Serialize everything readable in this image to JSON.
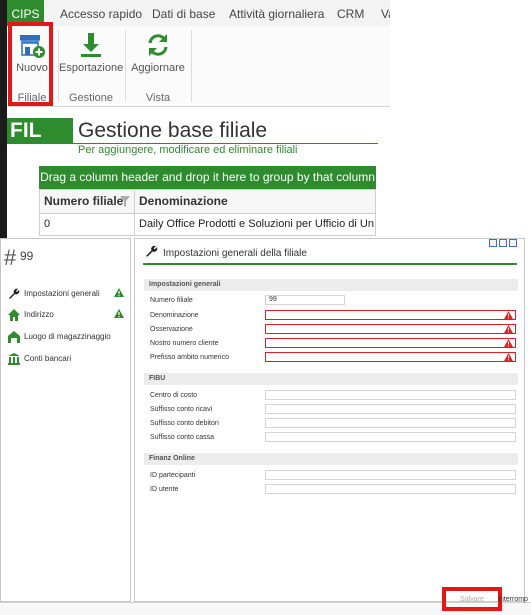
{
  "tabs": [
    "CIPS",
    "Accesso rapido",
    "Dati di base",
    "Attività giornaliera",
    "CRM",
    "Va"
  ],
  "ribbon": {
    "buttons": {
      "new": "Nuovo",
      "export": "Esportazione",
      "refresh": "Aggiornare"
    },
    "groups": {
      "branch": "Filiale",
      "management": "Gestione",
      "view": "Vista"
    }
  },
  "header": {
    "badge": "FIL",
    "title": "Gestione base filiale",
    "subtitle": "Per aggiungere, modificare ed eliminare filiali"
  },
  "grid": {
    "group_hint": "Drag a column header and drop it here to group by that column",
    "columns": [
      "Numero filiale",
      "Denominazione"
    ],
    "rows": [
      [
        "0",
        "Daily Office Prodotti e Soluzioni per Ufficio di Un"
      ]
    ]
  },
  "record": {
    "hash": "#",
    "id": "99"
  },
  "nav": [
    "Impostazioni generali",
    "Indirizzo",
    "Luogo di magazzinaggio",
    "Conti bancari"
  ],
  "settings": {
    "title": "Impostazioni generali della filiale",
    "sections": {
      "general": {
        "label": "Impostazioni generali",
        "fields": [
          {
            "label": "Numero filiale",
            "value": "99"
          },
          {
            "label": "Denominazione",
            "value": ""
          },
          {
            "label": "Osservazione",
            "value": ""
          },
          {
            "label": "Nostro numero cliente",
            "value": ""
          },
          {
            "label": "Prefisso ambito numerico",
            "value": ""
          }
        ]
      },
      "fibu": {
        "label": "FIBU",
        "fields": [
          {
            "label": "Centro di costo",
            "value": ""
          },
          {
            "label": "Suffisso conto ricavi",
            "value": ""
          },
          {
            "label": "Suffisso conto debitori",
            "value": ""
          },
          {
            "label": "Suffisso conto cassa",
            "value": ""
          }
        ]
      },
      "finanz": {
        "label": "Finanz Online",
        "fields": [
          {
            "label": "ID partecipanti",
            "value": ""
          },
          {
            "label": "ID utente",
            "value": ""
          }
        ]
      }
    }
  },
  "footer": {
    "save": "Salvare",
    "cancel": "Interromp"
  },
  "colors": {
    "accent": "#2e8b2e",
    "highlight": "#e01818",
    "error": "#e02020"
  }
}
